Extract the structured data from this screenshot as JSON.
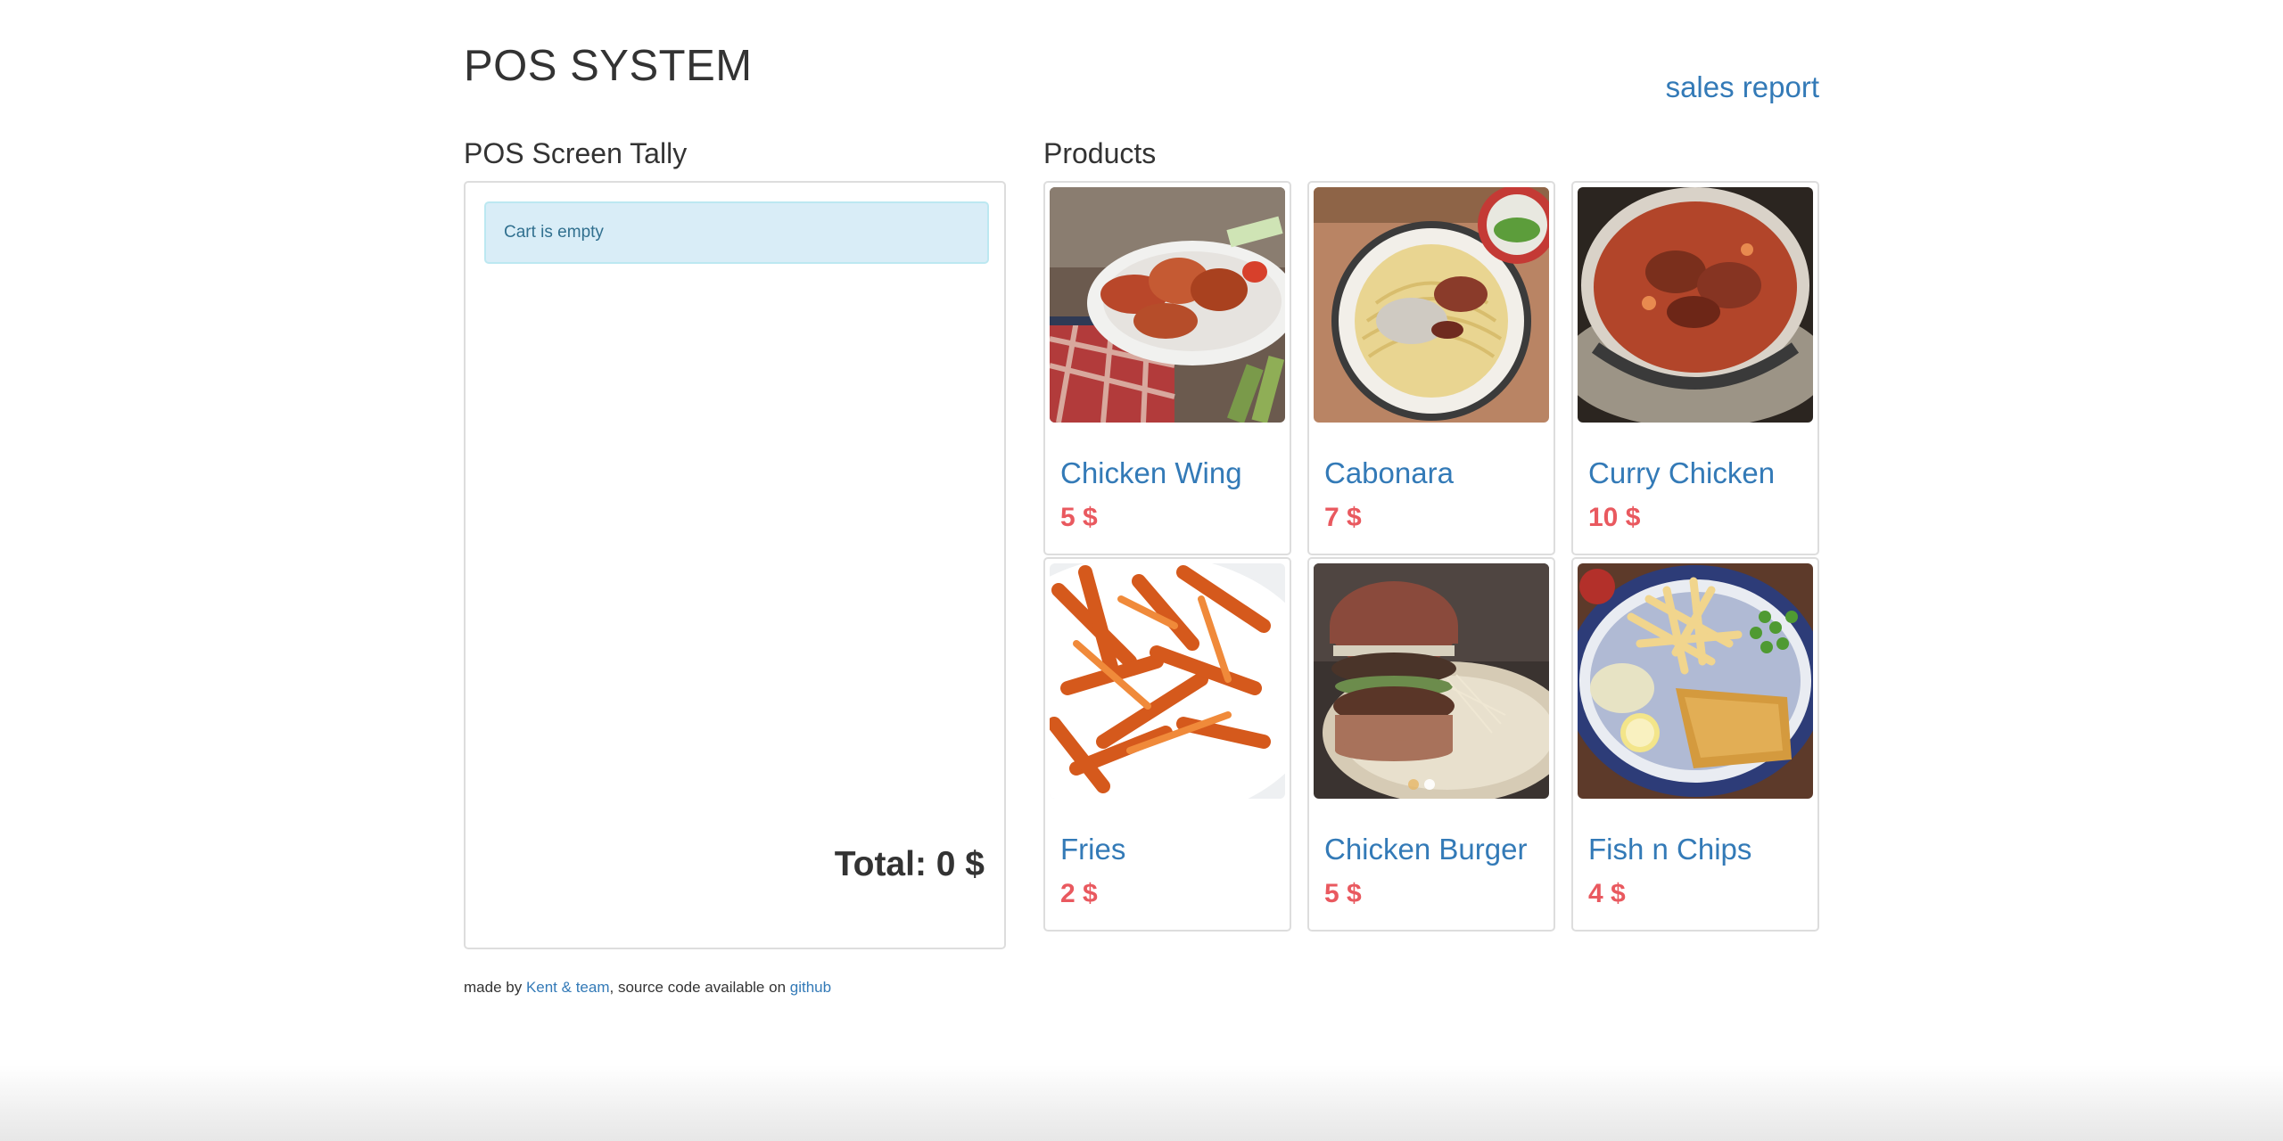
{
  "header": {
    "title": "POS SYSTEM",
    "sales_report_link": "sales report"
  },
  "tally": {
    "title": "POS Screen Tally",
    "cart_message": "Cart is empty",
    "total_text": "Total: 0 $"
  },
  "products": {
    "title": "Products",
    "items": [
      {
        "name": "Chicken Wing",
        "price": "5 $",
        "image_icon": "chicken-wing-photo"
      },
      {
        "name": "Cabonara",
        "price": "7 $",
        "image_icon": "carbonara-photo"
      },
      {
        "name": "Curry Chicken",
        "price": "10 $",
        "image_icon": "curry-chicken-photo"
      },
      {
        "name": "Fries",
        "price": "2 $",
        "image_icon": "fries-photo"
      },
      {
        "name": "Chicken Burger",
        "price": "5 $",
        "image_icon": "chicken-burger-photo"
      },
      {
        "name": "Fish n Chips",
        "price": "4 $",
        "image_icon": "fish-n-chips-photo"
      }
    ]
  },
  "footer": {
    "prefix": "made by ",
    "author_link": "Kent & team",
    "middle": ", source code available on ",
    "source_link": "github"
  },
  "colors": {
    "link": "#337ab7",
    "price": "#e9595f",
    "alert_bg": "#d9edf7",
    "alert_text": "#31708f"
  }
}
